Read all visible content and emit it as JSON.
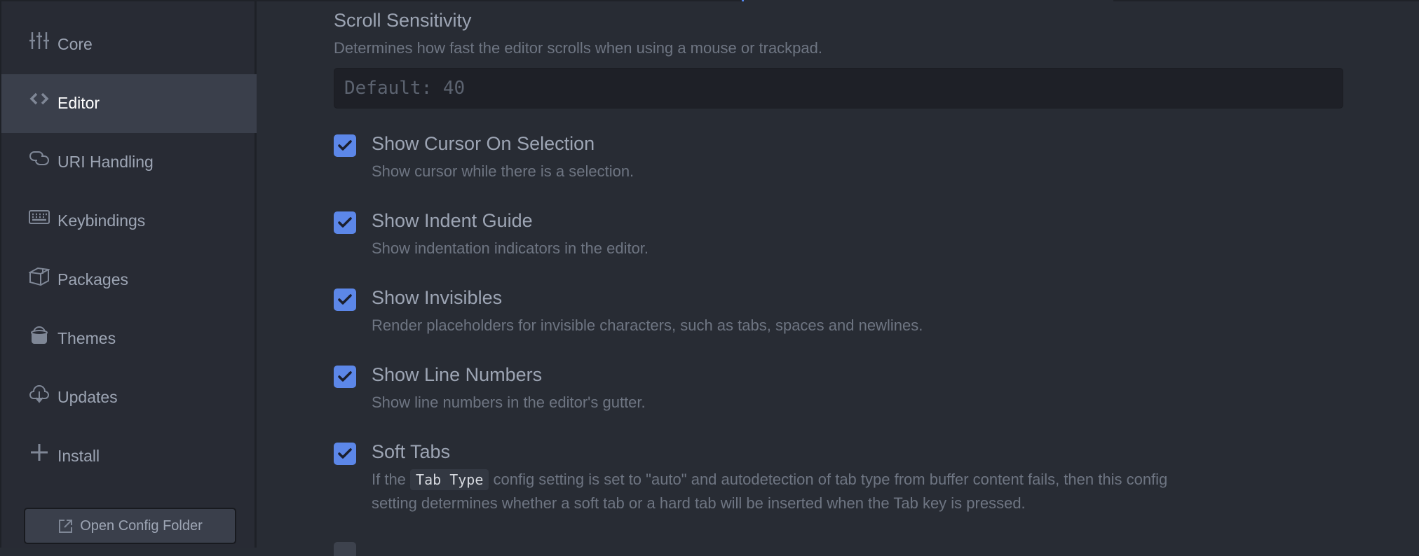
{
  "sidebar": {
    "items": [
      {
        "label": "Core",
        "icon": "sliders-icon",
        "active": false
      },
      {
        "label": "Editor",
        "icon": "code-icon",
        "active": true
      },
      {
        "label": "URI Handling",
        "icon": "link-icon",
        "active": false
      },
      {
        "label": "Keybindings",
        "icon": "keyboard-icon",
        "active": false
      },
      {
        "label": "Packages",
        "icon": "package-icon",
        "active": false
      },
      {
        "label": "Themes",
        "icon": "paintcan-icon",
        "active": false
      },
      {
        "label": "Updates",
        "icon": "cloud-download-icon",
        "active": false
      },
      {
        "label": "Install",
        "icon": "plus-icon",
        "active": false
      }
    ],
    "open_config_label": "Open Config Folder"
  },
  "main": {
    "scroll_sensitivity": {
      "title": "Scroll Sensitivity",
      "description": "Determines how fast the editor scrolls when using a mouse or trackpad.",
      "value": "",
      "placeholder": "Default: 40"
    },
    "checkboxes": [
      {
        "label": "Show Cursor On Selection",
        "description": "Show cursor while there is a selection.",
        "checked": true
      },
      {
        "label": "Show Indent Guide",
        "description": "Show indentation indicators in the editor.",
        "checked": true
      },
      {
        "label": "Show Invisibles",
        "description": "Render placeholders for invisible characters, such as tabs, spaces and newlines.",
        "checked": true
      },
      {
        "label": "Show Line Numbers",
        "description": "Show line numbers in the editor's gutter.",
        "checked": true
      },
      {
        "label": "Soft Tabs",
        "checked": true,
        "description_parts": {
          "pre": "If the ",
          "code": "Tab Type",
          "post": " config setting is set to \"auto\" and autodetection of tab type from buffer content fails, then this config",
          "line2": "setting determines whether a soft tab or a hard tab will be inserted when the Tab key is pressed."
        }
      }
    ]
  },
  "colors": {
    "accent": "#5c87e8",
    "background": "#282c34",
    "sidebar_active": "#3a3f4b",
    "text": "#9da5b4",
    "muted_text": "#6e7582"
  }
}
